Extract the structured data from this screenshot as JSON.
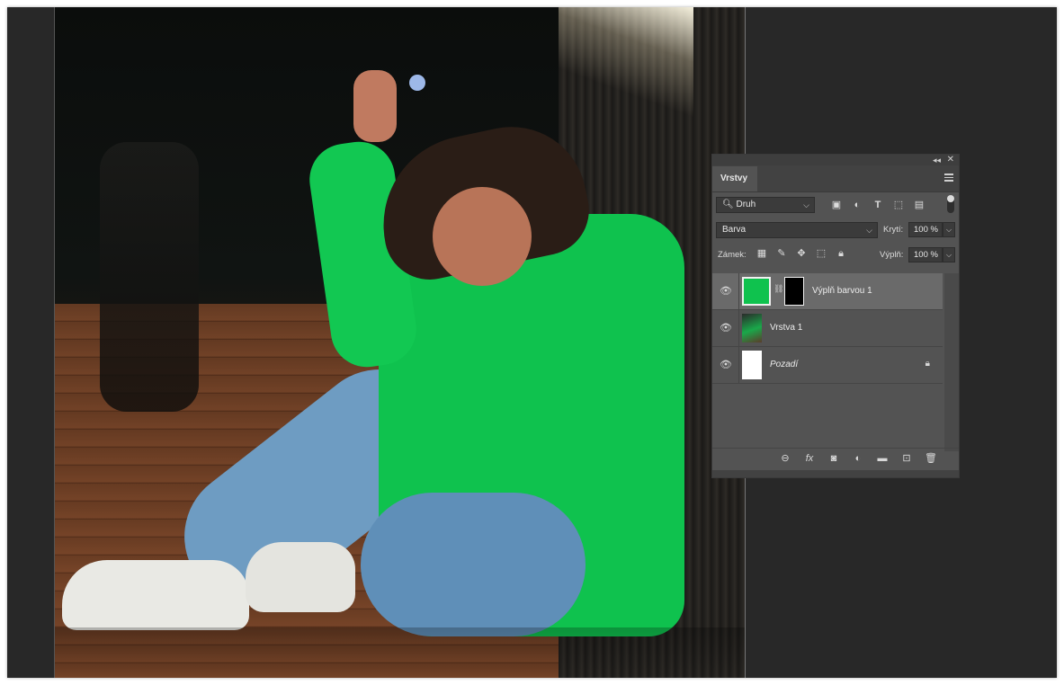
{
  "layers_panel": {
    "tab": "Vrstvy",
    "filter": {
      "label": "Druh",
      "icons": [
        "image-filter-icon",
        "adjustment-filter-icon",
        "type-filter-icon",
        "shape-filter-icon",
        "smart-object-filter-icon"
      ]
    },
    "blend_mode": "Barva",
    "opacity_label": "Krytí:",
    "opacity_value": "100 %",
    "lock_label": "Zámek:",
    "lock_icons": [
      "lock-transparent-icon",
      "lock-image-icon",
      "lock-position-icon",
      "lock-artboard-icon",
      "lock-all-icon"
    ],
    "fill_label": "Výplň:",
    "fill_value": "100 %",
    "layers": [
      {
        "name": "Výplň barvou 1",
        "selected": true,
        "thumb_color": "#0fc24e",
        "has_mask": true
      },
      {
        "name": "Vrstva 1",
        "selected": false
      },
      {
        "name": "Pozadí",
        "selected": false,
        "italic": true,
        "locked": true
      }
    ],
    "bottom_icons": [
      "link-layers-icon",
      "fx-icon",
      "add-mask-icon",
      "adjustment-layer-icon",
      "group-folder-icon",
      "new-layer-icon",
      "trash-icon"
    ]
  },
  "colors": {
    "fill_green": "#0fc24e",
    "panel_bg": "#535353",
    "workspace": "#282828"
  }
}
